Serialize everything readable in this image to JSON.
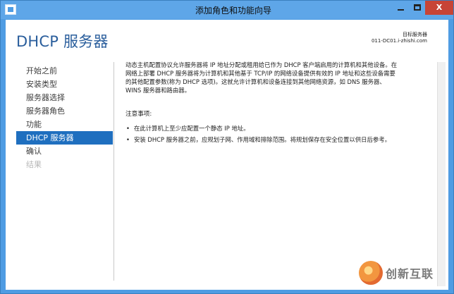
{
  "window": {
    "title": "添加角色和功能向导",
    "min_label": "",
    "max_label": "",
    "close_label": "X"
  },
  "header": {
    "page_title": "DHCP 服务器",
    "target_label": "目标服务器",
    "target_value": "011-DC01.i-zhishi.com"
  },
  "nav": {
    "items": [
      {
        "label": "开始之前",
        "state": "normal"
      },
      {
        "label": "安装类型",
        "state": "normal"
      },
      {
        "label": "服务器选择",
        "state": "normal"
      },
      {
        "label": "服务器角色",
        "state": "normal"
      },
      {
        "label": "功能",
        "state": "normal"
      },
      {
        "label": "DHCP 服务器",
        "state": "active"
      },
      {
        "label": "确认",
        "state": "normal"
      },
      {
        "label": "结果",
        "state": "disabled"
      }
    ]
  },
  "content": {
    "description": "动态主机配置协议允许服务器将 IP 地址分配或租用给已作为 DHCP 客户端启用的计算机和其他设备。在\n网络上部署 DHCP 服务器将为计算机和其他基于 TCP/IP 的网络设备提供有效的 IP 地址和这些设备需要\n的其他配置参数(称为 DHCP 选项)。这就允许计算机和设备连接到其他网络资源，如 DNS 服务器、\nWINS 服务器和路由器。",
    "notes_heading": "注意事项:",
    "notes": [
      "在此计算机上至少应配置一个静态 IP 地址。",
      "安装 DHCP 服务器之前，应规划子网、作用域和排除范围。将规划保存在安全位置以供日后参考。"
    ],
    "bullet": "•"
  },
  "watermark": {
    "text": "创新互联"
  },
  "colors": {
    "titlebar": "#5ea6e8",
    "frame": "#4f9ce3",
    "accent": "#1f6fbf",
    "page_title": "#2a5e9c",
    "close": "#c74436"
  }
}
